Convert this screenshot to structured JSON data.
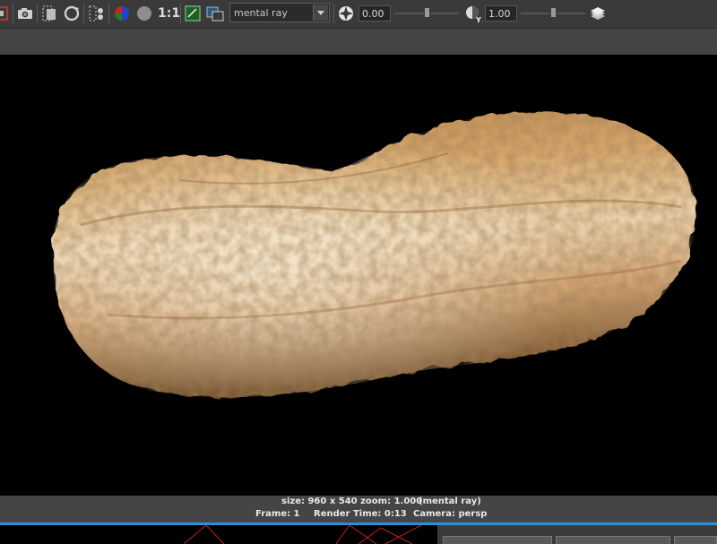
{
  "toolbar": {
    "renderer": "mental ray",
    "ratio_label": "1:1",
    "exposure_value": "0.00",
    "gamma_value": "1.00",
    "exposure_level": 0.5,
    "gamma_level": 0.5
  },
  "status": {
    "size_zoom": "size: 960 x 540 zoom: 1.000",
    "renderer": "(mental ray)",
    "frame": "Frame: 1",
    "render_time": "Render Time: 0:13",
    "camera": "Camera: persp"
  },
  "colors": {
    "accent": "#2e8fcf",
    "toolbar_bg": "#3a3a3a",
    "status_bg": "#454545"
  }
}
